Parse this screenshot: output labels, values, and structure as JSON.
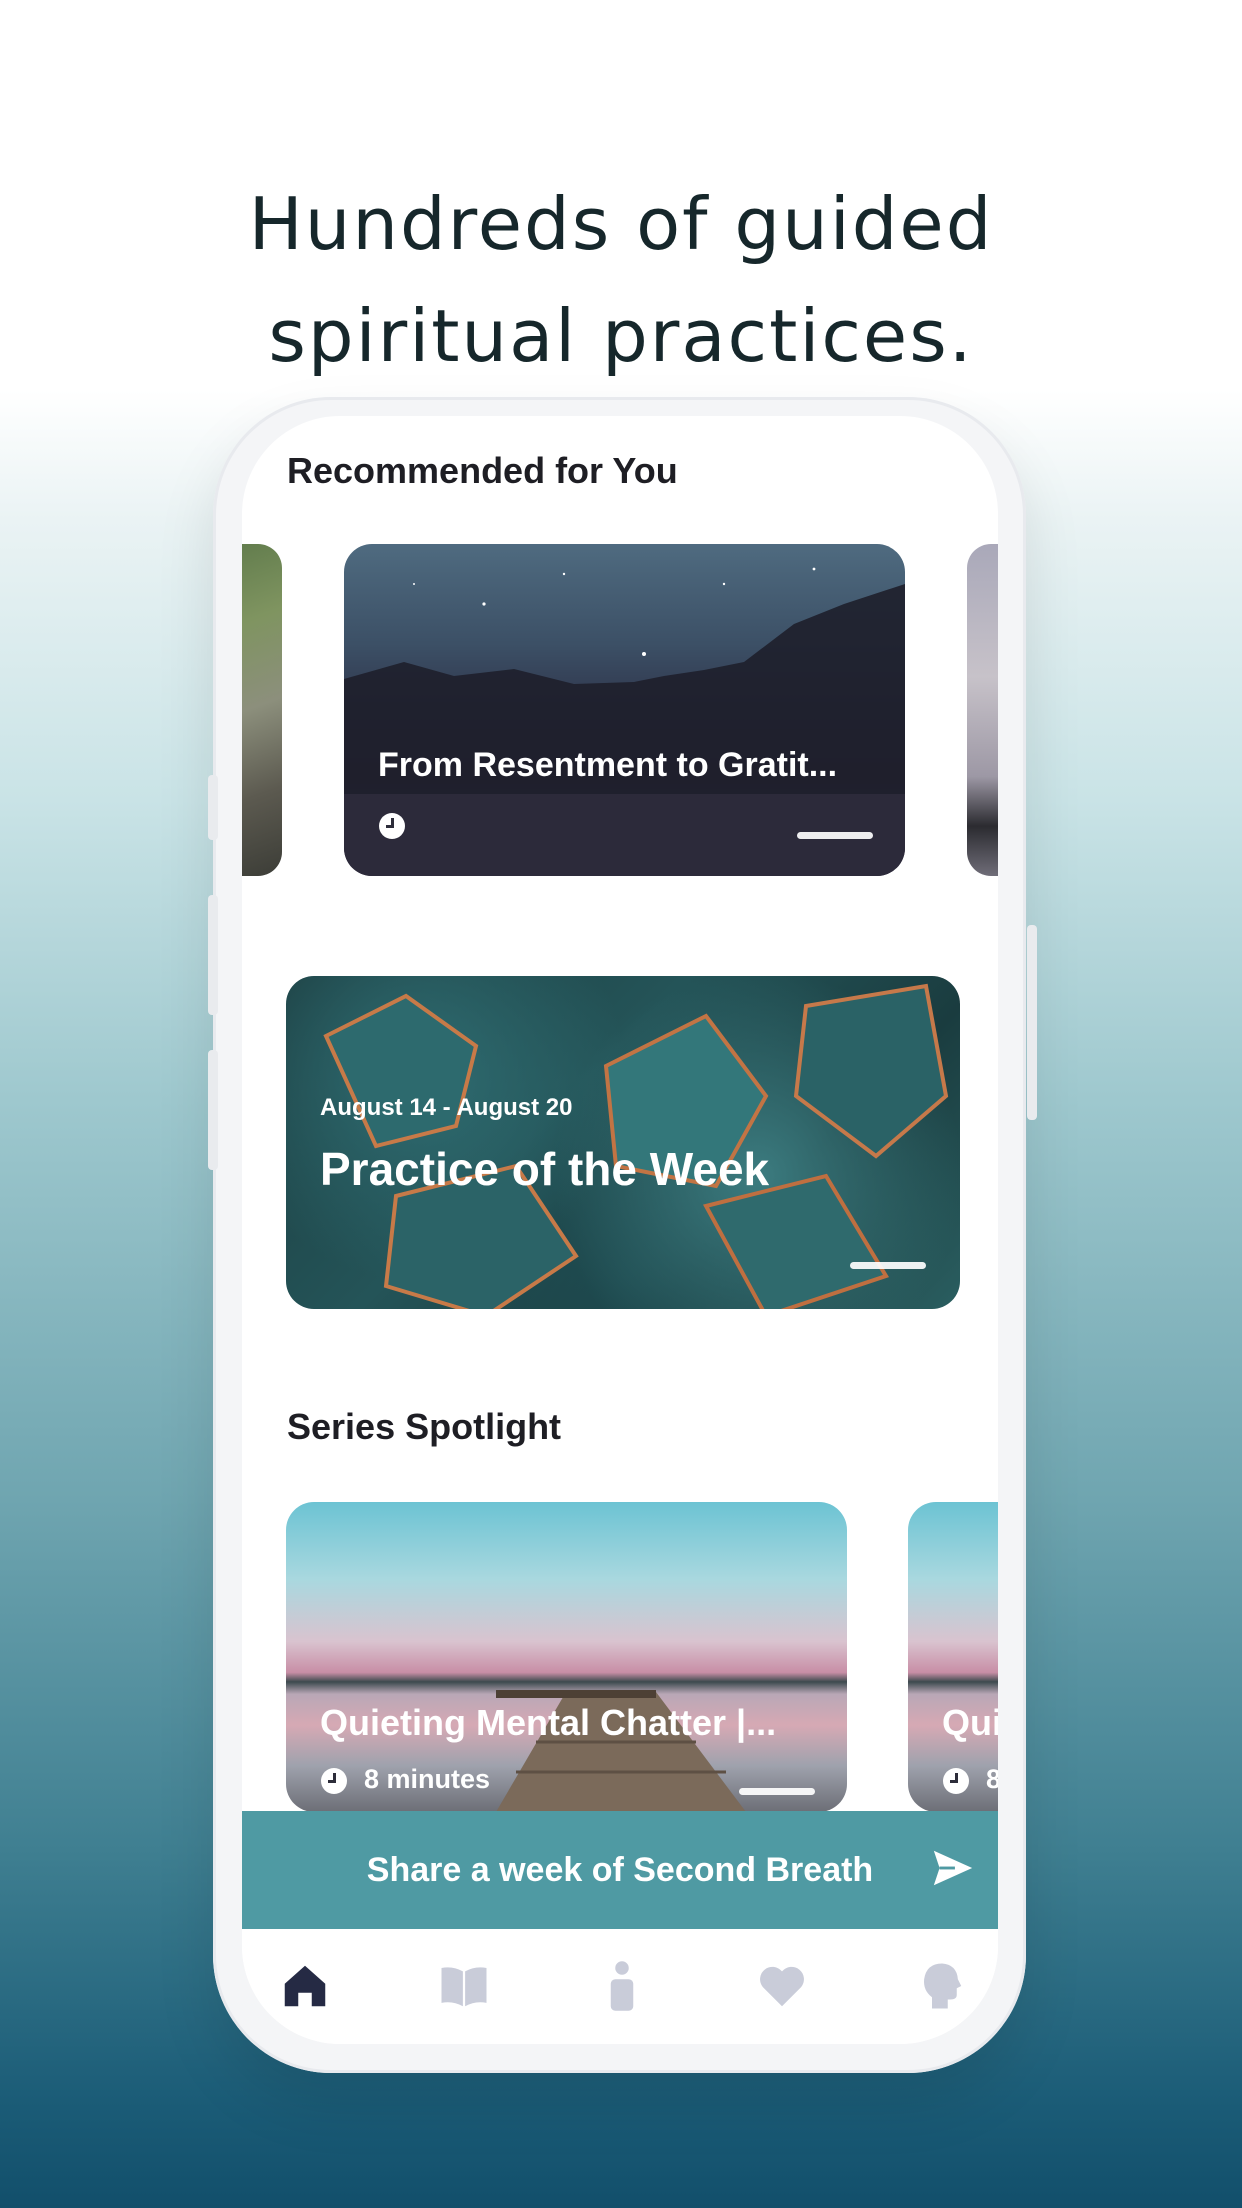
{
  "headline": {
    "line1": "Hundreds of guided",
    "line2": "spiritual practices."
  },
  "sections": {
    "recommended_title": "Recommended for You",
    "series_title": "Series Spotlight"
  },
  "recommended_card": {
    "title": "From Resentment to Gratit..."
  },
  "practice_card": {
    "dates": "August 14 - August 20",
    "title": "Practice of the Week"
  },
  "series_card": {
    "title": "Quieting Mental Chatter |...",
    "duration": "8 minutes"
  },
  "series_card_peek": {
    "title": "Qui",
    "duration": "8"
  },
  "share_bar": {
    "label": "Share a week of Second Breath",
    "icon": "send-icon"
  },
  "tabs": [
    {
      "name": "home",
      "icon": "home-icon",
      "active": true
    },
    {
      "name": "library",
      "icon": "book-icon",
      "active": false
    },
    {
      "name": "practice",
      "icon": "person-icon",
      "active": false
    },
    {
      "name": "favorites",
      "icon": "heart-icon",
      "active": false
    },
    {
      "name": "profile",
      "icon": "head-icon",
      "active": false
    }
  ],
  "colors": {
    "accent": "#4f9aa3",
    "tab_active": "#252a44",
    "tab_inactive": "#c9ccd9",
    "headline": "#16272b"
  }
}
